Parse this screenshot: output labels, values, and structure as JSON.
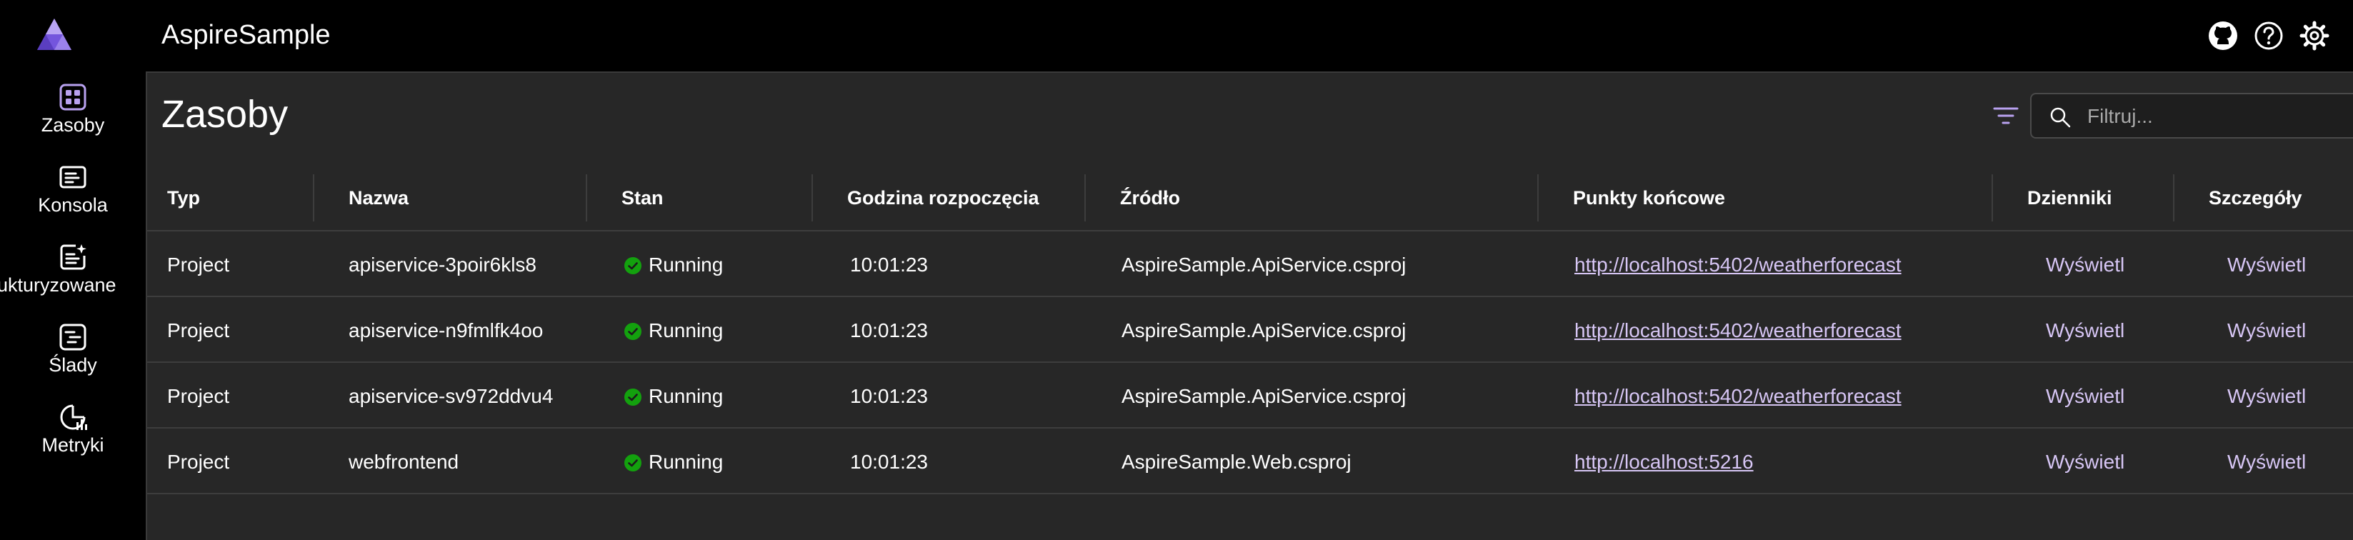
{
  "app": {
    "title": "AspireSample"
  },
  "colors": {
    "accent": "#b8a1ef",
    "success": "#13a10e",
    "link": "#d7c6f5"
  },
  "header_icons": [
    "github-icon",
    "help-icon",
    "settings-icon"
  ],
  "sidebar": {
    "items": [
      {
        "label": "Zasoby",
        "icon": "resources-grid-icon"
      },
      {
        "label": "Konsola",
        "icon": "console-icon"
      },
      {
        "label": "Strukturyzowane",
        "icon": "structured-logs-icon"
      },
      {
        "label": "Ślady",
        "icon": "traces-icon"
      },
      {
        "label": "Metryki",
        "icon": "metrics-icon"
      }
    ]
  },
  "main": {
    "title": "Zasoby",
    "search": {
      "placeholder": "Filtruj..."
    }
  },
  "table": {
    "headers": {
      "type": "Typ",
      "name": "Nazwa",
      "state": "Stan",
      "start_time": "Godzina rozpoczęcia",
      "source": "Źródło",
      "endpoints": "Punkty końcowe",
      "logs": "Dzienniki",
      "details": "Szczegóły"
    },
    "rows": [
      {
        "type": "Project",
        "name": "apiservice-3poir6kls8",
        "state": "Running",
        "start_time": "10:01:23",
        "source": "AspireSample.ApiService.csproj",
        "endpoint": "http://localhost:5402/weatherforecast",
        "logs": "Wyświetl",
        "details": "Wyświetl"
      },
      {
        "type": "Project",
        "name": "apiservice-n9fmlfk4oo",
        "state": "Running",
        "start_time": "10:01:23",
        "source": "AspireSample.ApiService.csproj",
        "endpoint": "http://localhost:5402/weatherforecast",
        "logs": "Wyświetl",
        "details": "Wyświetl"
      },
      {
        "type": "Project",
        "name": "apiservice-sv972ddvu4",
        "state": "Running",
        "start_time": "10:01:23",
        "source": "AspireSample.ApiService.csproj",
        "endpoint": "http://localhost:5402/weatherforecast",
        "logs": "Wyświetl",
        "details": "Wyświetl"
      },
      {
        "type": "Project",
        "name": "webfrontend",
        "state": "Running",
        "start_time": "10:01:23",
        "source": "AspireSample.Web.csproj",
        "endpoint": "http://localhost:5216",
        "logs": "Wyświetl",
        "details": "Wyświetl"
      }
    ]
  }
}
